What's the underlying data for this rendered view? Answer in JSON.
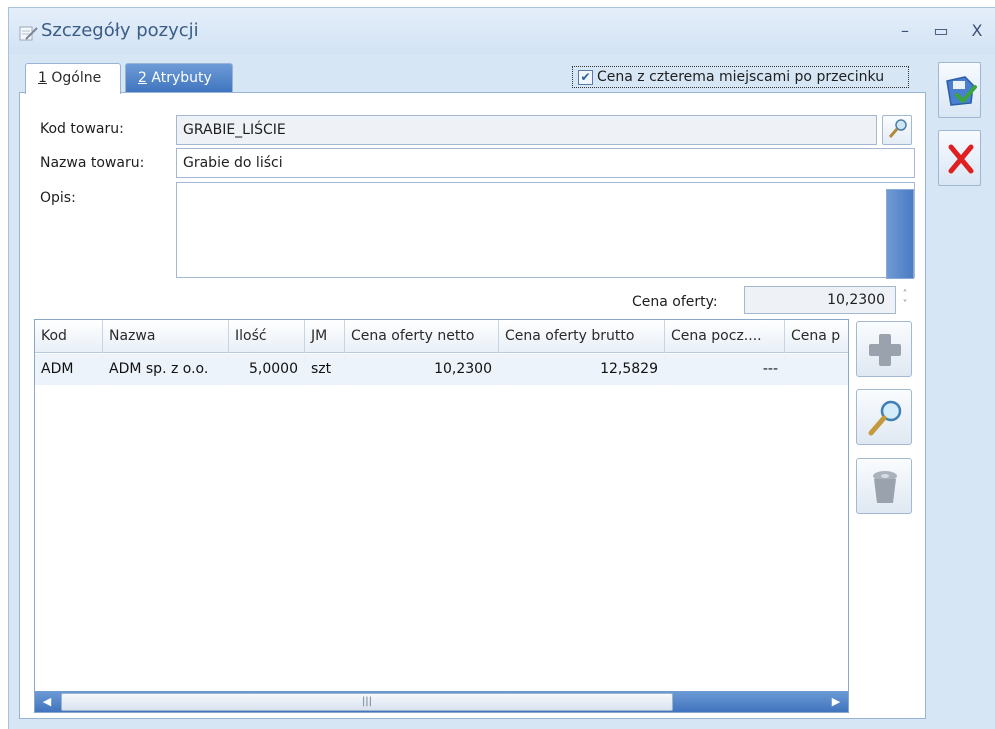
{
  "window": {
    "title": "Szczegóły pozycji",
    "minimize_glyph": "–",
    "maximize_glyph": "▭",
    "close_glyph": "X"
  },
  "tabs": [
    {
      "hotkey": "1",
      "label": " Ogólne"
    },
    {
      "hotkey": "2",
      "label": " Atrybuty"
    }
  ],
  "four_decimals": {
    "label": "Cena z czterema miejscami po przecinku",
    "checked": true
  },
  "form": {
    "kod_label": "Kod towaru:",
    "kod_value": "GRABIE_LIŚCIE",
    "nazwa_label": "Nazwa towaru:",
    "nazwa_value": "Grabie do liści",
    "opis_label": "Opis:",
    "opis_value": "",
    "cena_label": "Cena oferty:",
    "cena_value": "10,2300"
  },
  "grid": {
    "columns": [
      "Kod",
      "Nazwa",
      "Ilość",
      "JM",
      "Cena oferty netto",
      "Cena oferty brutto",
      "Cena pocz....",
      "Cena p"
    ],
    "rows": [
      [
        "ADM",
        "ADM sp. z o.o.",
        "5,0000",
        "szt",
        "10,2300",
        "12,5829",
        "---",
        ""
      ]
    ]
  },
  "icons": {
    "title": "document-pen-icon",
    "save": "save-disk-check-icon",
    "cancel": "red-x-icon",
    "add": "plus-icon",
    "preview": "magnifier-icon",
    "delete": "trash-bin-icon",
    "pick": "magnifier-small-icon"
  },
  "colors": {
    "window_bg": "#d6e6f5",
    "tab_active": "#ffffff",
    "tab_inactive": "#3f74bf",
    "scroll": "#4b7bc4",
    "cancel_red": "#e02020",
    "save_check": "#3aa63a"
  }
}
